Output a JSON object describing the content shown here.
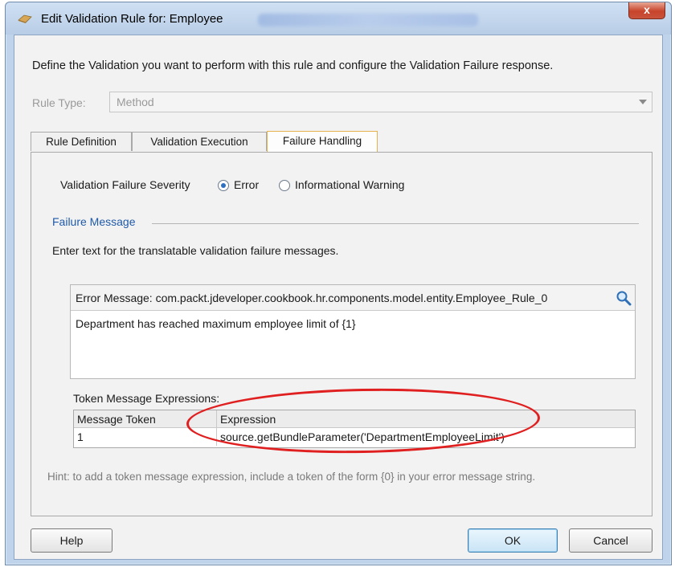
{
  "window": {
    "title": "Edit Validation Rule for: Employee",
    "close_symbol": "x"
  },
  "intro": "Define the Validation you want to perform with this rule and configure the Validation Failure response.",
  "rule_type": {
    "label": "Rule Type:",
    "value": "Method"
  },
  "tabs": [
    {
      "label": "Rule Definition"
    },
    {
      "label": "Validation Execution"
    },
    {
      "label": "Failure Handling"
    }
  ],
  "severity": {
    "label": "Validation Failure Severity",
    "options": [
      {
        "label": "Error",
        "selected": true
      },
      {
        "label": "Informational Warning",
        "selected": false
      }
    ]
  },
  "failure_message": {
    "section_label": "Failure Message",
    "description": "Enter text for the translatable validation failure messages.",
    "error_message_header": "Error Message: com.packt.jdeveloper.cookbook.hr.components.model.entity.Employee_Rule_0",
    "error_message_text": "Department has reached maximum employee limit of {1}"
  },
  "tokens": {
    "label": "Token Message Expressions:",
    "columns": [
      "Message Token",
      "Expression"
    ],
    "rows": [
      {
        "token": "1",
        "expression": "source.getBundleParameter('DepartmentEmployeeLimit')"
      }
    ]
  },
  "hint": "Hint: to add a token message expression, include a token of the form {0} in your error message string.",
  "buttons": {
    "help": "Help",
    "ok": "OK",
    "cancel": "Cancel"
  },
  "colors": {
    "annotation": "#e02020",
    "section_label": "#1f5aa8",
    "active_tab_border": "#e6b14f"
  }
}
